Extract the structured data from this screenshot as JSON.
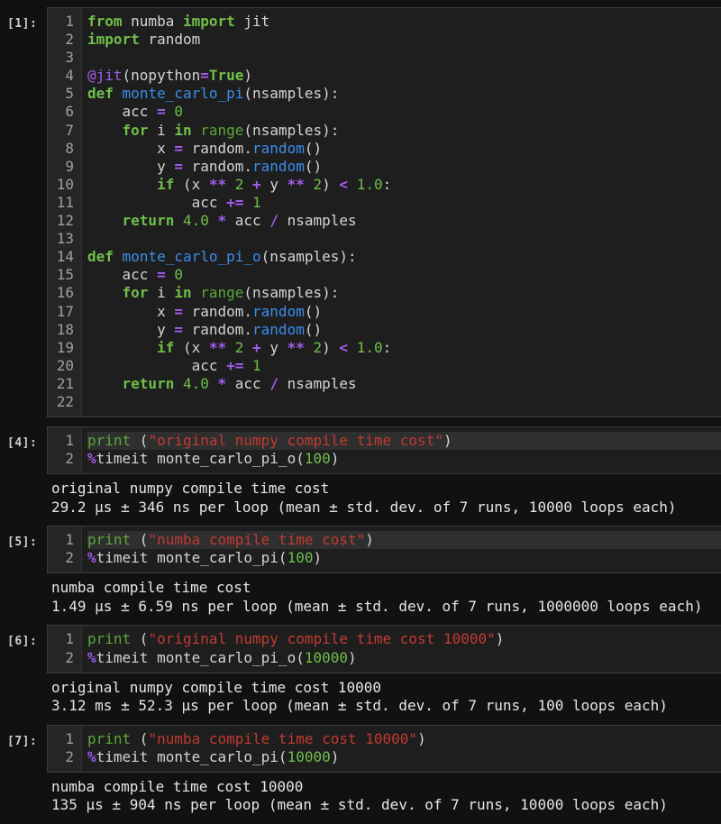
{
  "cells": [
    {
      "prompt": "[1]:",
      "line_numbers": [
        "1",
        "2",
        "3",
        "4",
        "5",
        "6",
        "7",
        "8",
        "9",
        "10",
        "11",
        "12",
        "13",
        "14",
        "15",
        "16",
        "17",
        "18",
        "19",
        "20",
        "21",
        "22"
      ],
      "code_lines": [
        [
          {
            "t": "from",
            "c": "kw"
          },
          {
            "t": " numba ",
            "c": "plain"
          },
          {
            "t": "import",
            "c": "kw"
          },
          {
            "t": " jit",
            "c": "plain"
          }
        ],
        [
          {
            "t": "import",
            "c": "kw"
          },
          {
            "t": " random",
            "c": "plain"
          }
        ],
        [],
        [
          {
            "t": "@jit",
            "c": "dec"
          },
          {
            "t": "(nopython",
            "c": "plain"
          },
          {
            "t": "=",
            "c": "op"
          },
          {
            "t": "True",
            "c": "kw"
          },
          {
            "t": ")",
            "c": "plain"
          }
        ],
        [
          {
            "t": "def",
            "c": "kw"
          },
          {
            "t": " ",
            "c": "plain"
          },
          {
            "t": "monte_carlo_pi",
            "c": "fn"
          },
          {
            "t": "(nsamples):",
            "c": "plain"
          }
        ],
        [
          {
            "t": "    acc ",
            "c": "plain"
          },
          {
            "t": "=",
            "c": "op"
          },
          {
            "t": " ",
            "c": "plain"
          },
          {
            "t": "0",
            "c": "num"
          }
        ],
        [
          {
            "t": "    ",
            "c": "plain"
          },
          {
            "t": "for",
            "c": "kw"
          },
          {
            "t": " i ",
            "c": "plain"
          },
          {
            "t": "in",
            "c": "kw"
          },
          {
            "t": " ",
            "c": "plain"
          },
          {
            "t": "range",
            "c": "bi"
          },
          {
            "t": "(nsamples):",
            "c": "plain"
          }
        ],
        [
          {
            "t": "        x ",
            "c": "plain"
          },
          {
            "t": "=",
            "c": "op"
          },
          {
            "t": " random.",
            "c": "plain"
          },
          {
            "t": "random",
            "c": "fn"
          },
          {
            "t": "()",
            "c": "plain"
          }
        ],
        [
          {
            "t": "        y ",
            "c": "plain"
          },
          {
            "t": "=",
            "c": "op"
          },
          {
            "t": " random.",
            "c": "plain"
          },
          {
            "t": "random",
            "c": "fn"
          },
          {
            "t": "()",
            "c": "plain"
          }
        ],
        [
          {
            "t": "        ",
            "c": "plain"
          },
          {
            "t": "if",
            "c": "kw"
          },
          {
            "t": " (x ",
            "c": "plain"
          },
          {
            "t": "**",
            "c": "op"
          },
          {
            "t": " ",
            "c": "plain"
          },
          {
            "t": "2",
            "c": "num"
          },
          {
            "t": " ",
            "c": "plain"
          },
          {
            "t": "+",
            "c": "op"
          },
          {
            "t": " y ",
            "c": "plain"
          },
          {
            "t": "**",
            "c": "op"
          },
          {
            "t": " ",
            "c": "plain"
          },
          {
            "t": "2",
            "c": "num"
          },
          {
            "t": ") ",
            "c": "plain"
          },
          {
            "t": "<",
            "c": "op"
          },
          {
            "t": " ",
            "c": "plain"
          },
          {
            "t": "1.0",
            "c": "num"
          },
          {
            "t": ":",
            "c": "plain"
          }
        ],
        [
          {
            "t": "            acc ",
            "c": "plain"
          },
          {
            "t": "+=",
            "c": "op"
          },
          {
            "t": " ",
            "c": "plain"
          },
          {
            "t": "1",
            "c": "num"
          }
        ],
        [
          {
            "t": "    ",
            "c": "plain"
          },
          {
            "t": "return",
            "c": "kw"
          },
          {
            "t": " ",
            "c": "plain"
          },
          {
            "t": "4.0",
            "c": "num"
          },
          {
            "t": " ",
            "c": "plain"
          },
          {
            "t": "*",
            "c": "op"
          },
          {
            "t": " acc ",
            "c": "plain"
          },
          {
            "t": "/",
            "c": "op"
          },
          {
            "t": " nsamples",
            "c": "plain"
          }
        ],
        [],
        [
          {
            "t": "def",
            "c": "kw"
          },
          {
            "t": " ",
            "c": "plain"
          },
          {
            "t": "monte_carlo_pi_o",
            "c": "fn"
          },
          {
            "t": "(nsamples):",
            "c": "plain"
          }
        ],
        [
          {
            "t": "    acc ",
            "c": "plain"
          },
          {
            "t": "=",
            "c": "op"
          },
          {
            "t": " ",
            "c": "plain"
          },
          {
            "t": "0",
            "c": "num"
          }
        ],
        [
          {
            "t": "    ",
            "c": "plain"
          },
          {
            "t": "for",
            "c": "kw"
          },
          {
            "t": " i ",
            "c": "plain"
          },
          {
            "t": "in",
            "c": "kw"
          },
          {
            "t": " ",
            "c": "plain"
          },
          {
            "t": "range",
            "c": "bi"
          },
          {
            "t": "(nsamples):",
            "c": "plain"
          }
        ],
        [
          {
            "t": "        x ",
            "c": "plain"
          },
          {
            "t": "=",
            "c": "op"
          },
          {
            "t": " random.",
            "c": "plain"
          },
          {
            "t": "random",
            "c": "fn"
          },
          {
            "t": "()",
            "c": "plain"
          }
        ],
        [
          {
            "t": "        y ",
            "c": "plain"
          },
          {
            "t": "=",
            "c": "op"
          },
          {
            "t": " random.",
            "c": "plain"
          },
          {
            "t": "random",
            "c": "fn"
          },
          {
            "t": "()",
            "c": "plain"
          }
        ],
        [
          {
            "t": "        ",
            "c": "plain"
          },
          {
            "t": "if",
            "c": "kw"
          },
          {
            "t": " (x ",
            "c": "plain"
          },
          {
            "t": "**",
            "c": "op"
          },
          {
            "t": " ",
            "c": "plain"
          },
          {
            "t": "2",
            "c": "num"
          },
          {
            "t": " ",
            "c": "plain"
          },
          {
            "t": "+",
            "c": "op"
          },
          {
            "t": " y ",
            "c": "plain"
          },
          {
            "t": "**",
            "c": "op"
          },
          {
            "t": " ",
            "c": "plain"
          },
          {
            "t": "2",
            "c": "num"
          },
          {
            "t": ") ",
            "c": "plain"
          },
          {
            "t": "<",
            "c": "op"
          },
          {
            "t": " ",
            "c": "plain"
          },
          {
            "t": "1.0",
            "c": "num"
          },
          {
            "t": ":",
            "c": "plain"
          }
        ],
        [
          {
            "t": "            acc ",
            "c": "plain"
          },
          {
            "t": "+=",
            "c": "op"
          },
          {
            "t": " ",
            "c": "plain"
          },
          {
            "t": "1",
            "c": "num"
          }
        ],
        [
          {
            "t": "    ",
            "c": "plain"
          },
          {
            "t": "return",
            "c": "kw"
          },
          {
            "t": " ",
            "c": "plain"
          },
          {
            "t": "4.0",
            "c": "num"
          },
          {
            "t": " ",
            "c": "plain"
          },
          {
            "t": "*",
            "c": "op"
          },
          {
            "t": " acc ",
            "c": "plain"
          },
          {
            "t": "/",
            "c": "op"
          },
          {
            "t": " nsamples",
            "c": "plain"
          }
        ],
        []
      ],
      "highlight_line": -1,
      "output": []
    },
    {
      "prompt": "[4]:",
      "line_numbers": [
        "1",
        "2"
      ],
      "code_lines": [
        [
          {
            "t": "print",
            "c": "bi"
          },
          {
            "t": " (",
            "c": "plain"
          },
          {
            "t": "\"original numpy compile time cost\"",
            "c": "str"
          },
          {
            "t": ")",
            "c": "plain"
          }
        ],
        [
          {
            "t": "%",
            "c": "pct"
          },
          {
            "t": "timeit monte_carlo_pi_o(",
            "c": "plain"
          },
          {
            "t": "100",
            "c": "num"
          },
          {
            "t": ")",
            "c": "plain"
          }
        ]
      ],
      "highlight_line": 0,
      "output": [
        "original numpy compile time cost",
        "29.2 µs ± 346 ns per loop (mean ± std. dev. of 7 runs, 10000 loops each)"
      ]
    },
    {
      "prompt": "[5]:",
      "line_numbers": [
        "1",
        "2"
      ],
      "code_lines": [
        [
          {
            "t": "print",
            "c": "bi"
          },
          {
            "t": " (",
            "c": "plain"
          },
          {
            "t": "\"numba compile time cost\"",
            "c": "str"
          },
          {
            "t": ")",
            "c": "plain"
          }
        ],
        [
          {
            "t": "%",
            "c": "pct"
          },
          {
            "t": "timeit monte_carlo_pi(",
            "c": "plain"
          },
          {
            "t": "100",
            "c": "num"
          },
          {
            "t": ")",
            "c": "plain"
          }
        ]
      ],
      "highlight_line": 0,
      "output": [
        "numba compile time cost",
        "1.49 µs ± 6.59 ns per loop (mean ± std. dev. of 7 runs, 1000000 loops each)"
      ]
    },
    {
      "prompt": "[6]:",
      "line_numbers": [
        "1",
        "2"
      ],
      "code_lines": [
        [
          {
            "t": "print",
            "c": "bi"
          },
          {
            "t": " (",
            "c": "plain"
          },
          {
            "t": "\"original numpy compile time cost 10000\"",
            "c": "str"
          },
          {
            "t": ")",
            "c": "plain"
          }
        ],
        [
          {
            "t": "%",
            "c": "pct"
          },
          {
            "t": "timeit monte_carlo_pi_o(",
            "c": "plain"
          },
          {
            "t": "10000",
            "c": "num"
          },
          {
            "t": ")",
            "c": "plain"
          }
        ]
      ],
      "highlight_line": -1,
      "output": [
        "original numpy compile time cost 10000",
        "3.12 ms ± 52.3 µs per loop (mean ± std. dev. of 7 runs, 100 loops each)"
      ]
    },
    {
      "prompt": "[7]:",
      "line_numbers": [
        "1",
        "2"
      ],
      "code_lines": [
        [
          {
            "t": "print",
            "c": "bi"
          },
          {
            "t": " (",
            "c": "plain"
          },
          {
            "t": "\"numba compile time cost 10000\"",
            "c": "str"
          },
          {
            "t": ")",
            "c": "plain"
          }
        ],
        [
          {
            "t": "%",
            "c": "pct"
          },
          {
            "t": "timeit monte_carlo_pi(",
            "c": "plain"
          },
          {
            "t": "10000",
            "c": "num"
          },
          {
            "t": ")",
            "c": "plain"
          }
        ]
      ],
      "highlight_line": -1,
      "output": [
        "numba compile time cost 10000",
        "135 µs ± 904 ns per loop (mean ± std. dev. of 7 runs, 10000 loops each)"
      ]
    }
  ]
}
